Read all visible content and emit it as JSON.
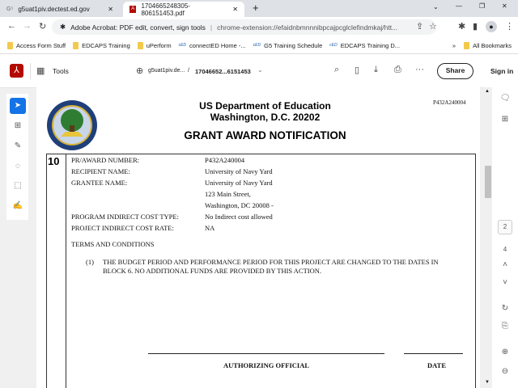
{
  "browser": {
    "tabs": [
      {
        "label": "g5uat1piv.dectest.ed.gov",
        "icon": "g5-icon"
      },
      {
        "label": "1704665248305-806151453.pdf",
        "icon": "pdf-icon",
        "active": true
      }
    ],
    "address_site": "Adobe Acrobat: PDF edit, convert, sign tools",
    "address_url": "chrome-extension://efaidnbmnnnibpcajpcglclefindmkaj/htt...",
    "bookmarks": [
      {
        "label": "Access Form Stuff",
        "type": "folder"
      },
      {
        "label": "EDCAPS Training",
        "type": "folder"
      },
      {
        "label": "uPerform",
        "type": "folder"
      },
      {
        "label": "connectED Home -...",
        "type": "ced"
      },
      {
        "label": "G5 Training Schedule",
        "type": "ced"
      },
      {
        "label": "EDCAPS Training D...",
        "type": "ced"
      }
    ],
    "bookmarks_overflow": "»",
    "all_bookmarks": "All Bookmarks",
    "ced_badge": "cED"
  },
  "acrobat": {
    "tools_label": "Tools",
    "file_site": "g5uat1piv.de...",
    "file_sep": "/",
    "file_name": "17046652...6151453",
    "share_label": "Share",
    "signin_label": "Sign in",
    "current_page": "2",
    "total_pages": "4"
  },
  "document": {
    "title1": "US Department of Education",
    "title2": "Washington, D.C. 20202",
    "heading": "GRANT AWARD NOTIFICATION",
    "ref": "P432A240004",
    "block_number": "10",
    "fields": [
      {
        "label": "PR/AWARD NUMBER:",
        "value": "P432A240004"
      },
      {
        "label": "RECIPIENT NAME:",
        "value": "University of Navy Yard"
      },
      {
        "label": "GRANTEE NAME:",
        "value": "University of Navy Yard"
      },
      {
        "label": "",
        "value": "123 Main Street,"
      },
      {
        "label": "",
        "value": "Washington, DC 20008 -"
      },
      {
        "label": "PROGRAM INDIRECT COST TYPE:",
        "value": "No Indirect cost allowed"
      },
      {
        "label": "PROJECT INDIRECT COST RATE:",
        "value": "NA"
      }
    ],
    "terms_heading": "TERMS AND CONDITIONS",
    "term_num": "(1)",
    "term_text": "THE BUDGET PERIOD AND PERFORMANCE PERIOD FOR THIS PROJECT ARE CHANGED TO THE DATES IN BLOCK 6. NO ADDITIONAL FUNDS ARE PROVIDED BY THIS ACTION.",
    "sig_label": "AUTHORIZING OFFICIAL",
    "date_label": "DATE",
    "seal_text": "DEPARTMENT OF EDUCATION · UNITED STATES OF AMERICA"
  },
  "colors": {
    "accent": "#1473e6",
    "acrobat_red": "#b30b00"
  }
}
